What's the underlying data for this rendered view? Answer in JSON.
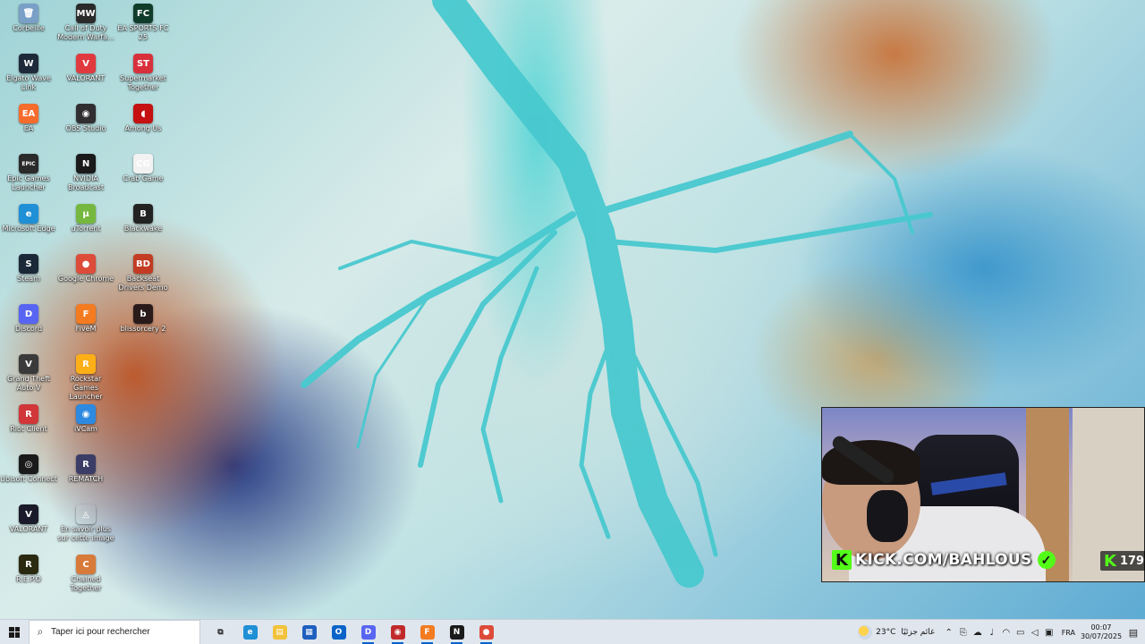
{
  "desktop": {
    "icons": [
      {
        "label": "Corbeille",
        "icon": "recycle-bin-icon",
        "color": "#7aa0c8",
        "glyph": "🗑"
      },
      {
        "label": "Call of Duty Modern Warfa...",
        "icon": "call-of-duty-icon",
        "color": "#2a2a2a",
        "glyph": "MW"
      },
      {
        "label": "EA SPORTS FC 25",
        "icon": "ea-sports-fc-icon",
        "color": "#0f3d2a",
        "glyph": "FC"
      },
      {
        "label": "Elgato Wave Link",
        "icon": "elgato-wave-link-icon",
        "color": "#1e2a3a",
        "glyph": "W"
      },
      {
        "label": "VALORANT",
        "icon": "valorant-icon",
        "color": "#e03a3e",
        "glyph": "V"
      },
      {
        "label": "Supermarket Together",
        "icon": "supermarket-together-icon",
        "color": "#d8303a",
        "glyph": "ST"
      },
      {
        "label": "EA",
        "icon": "ea-icon",
        "color": "#f56c2d",
        "glyph": "EA"
      },
      {
        "label": "OBS Studio",
        "icon": "obs-studio-icon",
        "color": "#302e31",
        "glyph": "◉"
      },
      {
        "label": "Among Us",
        "icon": "among-us-icon",
        "color": "#c51111",
        "glyph": "◖"
      },
      {
        "label": "Epic Games Launcher",
        "icon": "epic-games-icon",
        "color": "#2a2a2a",
        "glyph": "EPIC"
      },
      {
        "label": "NVIDIA Broadcast",
        "icon": "nvidia-broadcast-icon",
        "color": "#1a1a1a",
        "glyph": "N"
      },
      {
        "label": "Crab Game",
        "icon": "crab-game-icon",
        "color": "#f2f2f2",
        "glyph": "CG"
      },
      {
        "label": "Microsoft Edge",
        "icon": "edge-icon",
        "color": "#1f8fd6",
        "glyph": "e"
      },
      {
        "label": "uTorrent",
        "icon": "utorrent-icon",
        "color": "#76b83f",
        "glyph": "µ"
      },
      {
        "label": "Blackwake",
        "icon": "blackwake-icon",
        "color": "#222",
        "glyph": "B"
      },
      {
        "label": "Steam",
        "icon": "steam-icon",
        "color": "#1b2838",
        "glyph": "S"
      },
      {
        "label": "Google Chrome",
        "icon": "chrome-icon",
        "color": "#dd4b39",
        "glyph": "●"
      },
      {
        "label": "Backseat Drivers Demo",
        "icon": "backseat-drivers-icon",
        "color": "#c23b22",
        "glyph": "BD"
      },
      {
        "label": "Discord",
        "icon": "discord-icon",
        "color": "#5865f2",
        "glyph": "D"
      },
      {
        "label": "FiveM",
        "icon": "fivem-icon",
        "color": "#f47b20",
        "glyph": "F"
      },
      {
        "label": "blissorcery 2",
        "icon": "blissorcery-icon",
        "color": "#2a1a1a",
        "glyph": "b"
      },
      {
        "label": "Grand Theft Auto V",
        "icon": "gta-v-icon",
        "color": "#3a3a3a",
        "glyph": "V"
      },
      {
        "label": "Rockstar Games Launcher",
        "icon": "rockstar-icon",
        "color": "#fcaf17",
        "glyph": "R"
      },
      {
        "label": "Riot Client",
        "icon": "riot-client-icon",
        "color": "#d13639",
        "glyph": "R"
      },
      {
        "label": "iVCam",
        "icon": "ivcam-icon",
        "color": "#2d8ae0",
        "glyph": "◉"
      },
      {
        "label": "Ubisoft Connect",
        "icon": "ubisoft-connect-icon",
        "color": "#1a1a1a",
        "glyph": "◎"
      },
      {
        "label": "REMATCH",
        "icon": "rematch-icon",
        "color": "#3b3d66",
        "glyph": "R"
      },
      {
        "label": "VALORANT",
        "icon": "valorant-shortcut-icon",
        "color": "#1a1a2a",
        "glyph": "V"
      },
      {
        "label": "En savoir plus sur cette image",
        "icon": "learn-about-image-icon",
        "color": "transparent",
        "glyph": "◬"
      },
      {
        "label": "R.E.P.O",
        "icon": "repo-icon",
        "color": "#2a2a10",
        "glyph": "R"
      },
      {
        "label": "Chained Together",
        "icon": "chained-together-icon",
        "color": "#d87a3a",
        "glyph": "C"
      }
    ]
  },
  "stream_overlay": {
    "url": "KICK.COM/BAHLOUS",
    "logo": "K",
    "viewer_logo": "K",
    "viewer_count": "179",
    "accent": "#53fc18"
  },
  "taskbar": {
    "search_placeholder": "Taper ici pour rechercher",
    "apps": [
      {
        "icon": "task-view-icon",
        "glyph": "⧉",
        "color": "transparent"
      },
      {
        "icon": "edge-taskbar-icon",
        "glyph": "e",
        "color": "#1f8fd6"
      },
      {
        "icon": "file-explorer-icon",
        "glyph": "▤",
        "color": "#f2c23a"
      },
      {
        "icon": "store-icon",
        "glyph": "▦",
        "color": "#1e5fbf"
      },
      {
        "icon": "outlook-icon",
        "glyph": "O",
        "color": "#0a64c8"
      },
      {
        "icon": "discord-taskbar-icon",
        "glyph": "D",
        "color": "#5865f2"
      },
      {
        "icon": "obs-taskbar-icon",
        "glyph": "◉",
        "color": "#c12a2a"
      },
      {
        "icon": "fivem-taskbar-icon",
        "glyph": "F",
        "color": "#f47b20"
      },
      {
        "icon": "nvidia-taskbar-icon",
        "glyph": "N",
        "color": "#1a1a1a"
      },
      {
        "icon": "chrome-taskbar-icon",
        "glyph": "●",
        "color": "#dd4b39"
      }
    ],
    "weather_temp": "23°C",
    "weather_condition": "غائم جزئيًا",
    "language": "FRA",
    "time": "00:07",
    "date": "30/07/2025"
  }
}
